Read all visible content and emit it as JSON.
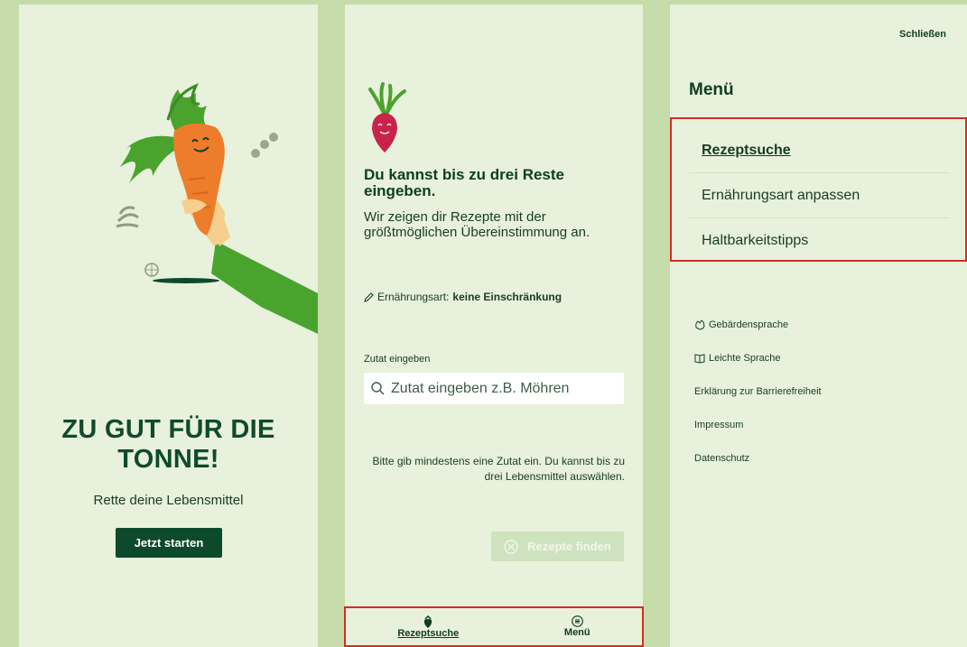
{
  "welcome": {
    "title_line1": "ZU GUT FÜR DIE",
    "title_line2": "TONNE!",
    "subtitle": "Rette deine Lebensmittel",
    "start_button": "Jetzt starten"
  },
  "search_screen": {
    "heading": "Du kannst bis zu drei Reste eingeben.",
    "description": "Wir zeigen dir Rezepte mit der größtmöglichen Übereinstimmung an.",
    "diet_label": "Ernährungsart:",
    "diet_value": "keine Einschränkung",
    "field_label": "Zutat eingeben",
    "search_placeholder": "Zutat eingeben z.B. Möhren",
    "hint": "Bitte gib mindestens eine Zutat ein. Du kannst bis zu drei Lebensmittel auswählen.",
    "find_button": "Rezepte finden",
    "nav": {
      "recipes": "Rezeptsuche",
      "menu": "Menü"
    }
  },
  "menu_screen": {
    "close": "Schließen",
    "title": "Menü",
    "items": [
      "Rezeptsuche",
      "Ernährungsart anpassen",
      "Haltbarkeitstipps"
    ],
    "links": [
      "Gebärdensprache",
      "Leichte Sprache",
      "Erklärung zur Barrierefreiheit",
      "Impressum",
      "Datenschutz"
    ]
  },
  "colors": {
    "background": "#c6dcaa",
    "screen": "#e8f1dc",
    "primary": "#0d4a2c",
    "highlight": "#d72b24",
    "carrot": "#ee7d2b",
    "leaf_green": "#4aa32d"
  }
}
